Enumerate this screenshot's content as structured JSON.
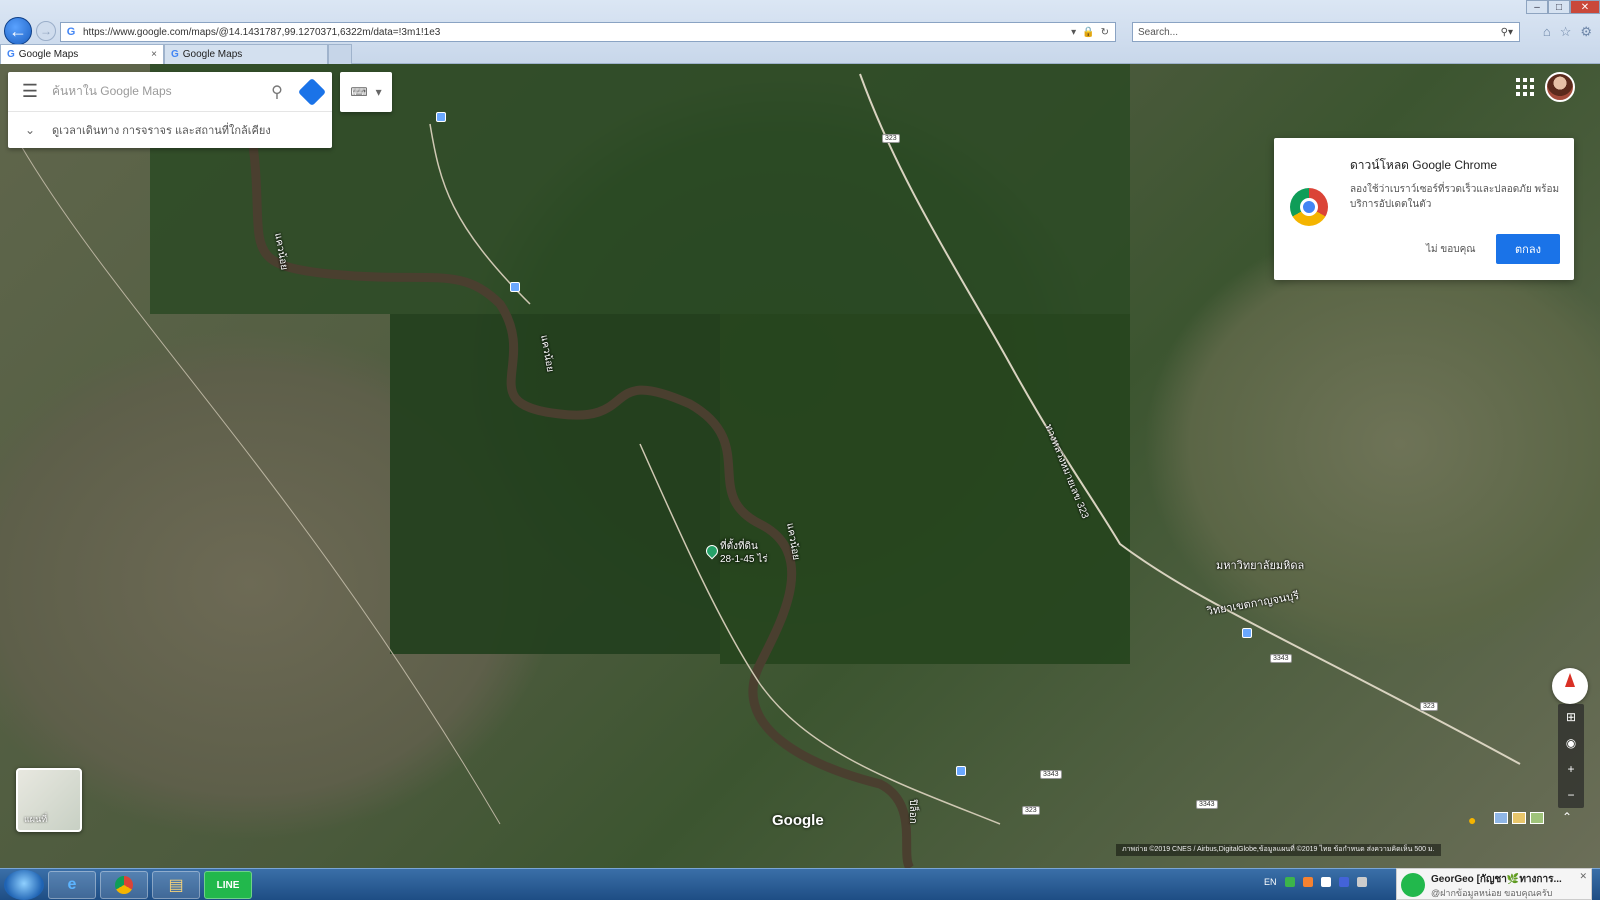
{
  "browser": {
    "url": "https://www.google.com/maps/@14.1431787,99.1270371,6322m/data=!3m1!1e3",
    "search_placeholder": "Search...",
    "tabs": [
      {
        "label": "Google Maps",
        "close": "×"
      },
      {
        "label": "Google Maps"
      }
    ]
  },
  "maps": {
    "search_placeholder": "ค้นหาใน Google Maps",
    "explore_text": "ดูเวลาเดินทาง การจราจร และสถานที่ใกล้เคียง",
    "watermark": "Google",
    "layer_label": "แผนที่",
    "attribution": "ภาพถ่าย ©2019 CNES / Airbus,DigitalGlobe,ข้อมูลแผนที่ ©2019   ไทย   ข้อกำหนด   ส่งความคิดเห็น   500 ม.",
    "pin_label_line1": "ที่ตั้งที่ดิน",
    "pin_label_line2": "28-1-45 ไร่",
    "labels": {
      "university": "มหาวิทยาลัยมหิดล",
      "university2": "วิทยาเขตกาญจนบุรี",
      "river1": "แควน้อย",
      "river2": "แควน้อย",
      "river3": "แควน้อย",
      "road_main": "ทางหลวงหมายเลข 323",
      "road_side": "ปิล็อก"
    },
    "route_shields": [
      "323",
      "323",
      "3343",
      "3343",
      "3343",
      "323"
    ]
  },
  "promo": {
    "title": "ดาวน์โหลด Google Chrome",
    "body": "ลองใช้ว่าเบราว์เซอร์ที่รวดเร็วและปลอดภัย พร้อมบริการอัปเดตในตัว",
    "dismiss": "ไม่ ขอบคุณ",
    "accept": "ตกลง"
  },
  "taskbar": {
    "lang": "EN",
    "notification_title": "GeorGeo [กัญชา🌿ทางการ...",
    "notification_text": "@ฝากข้อมูลหน่อย ขอบคุณครับ"
  },
  "colors": {
    "accent": "#1a73e8",
    "pin": "#26a269"
  }
}
